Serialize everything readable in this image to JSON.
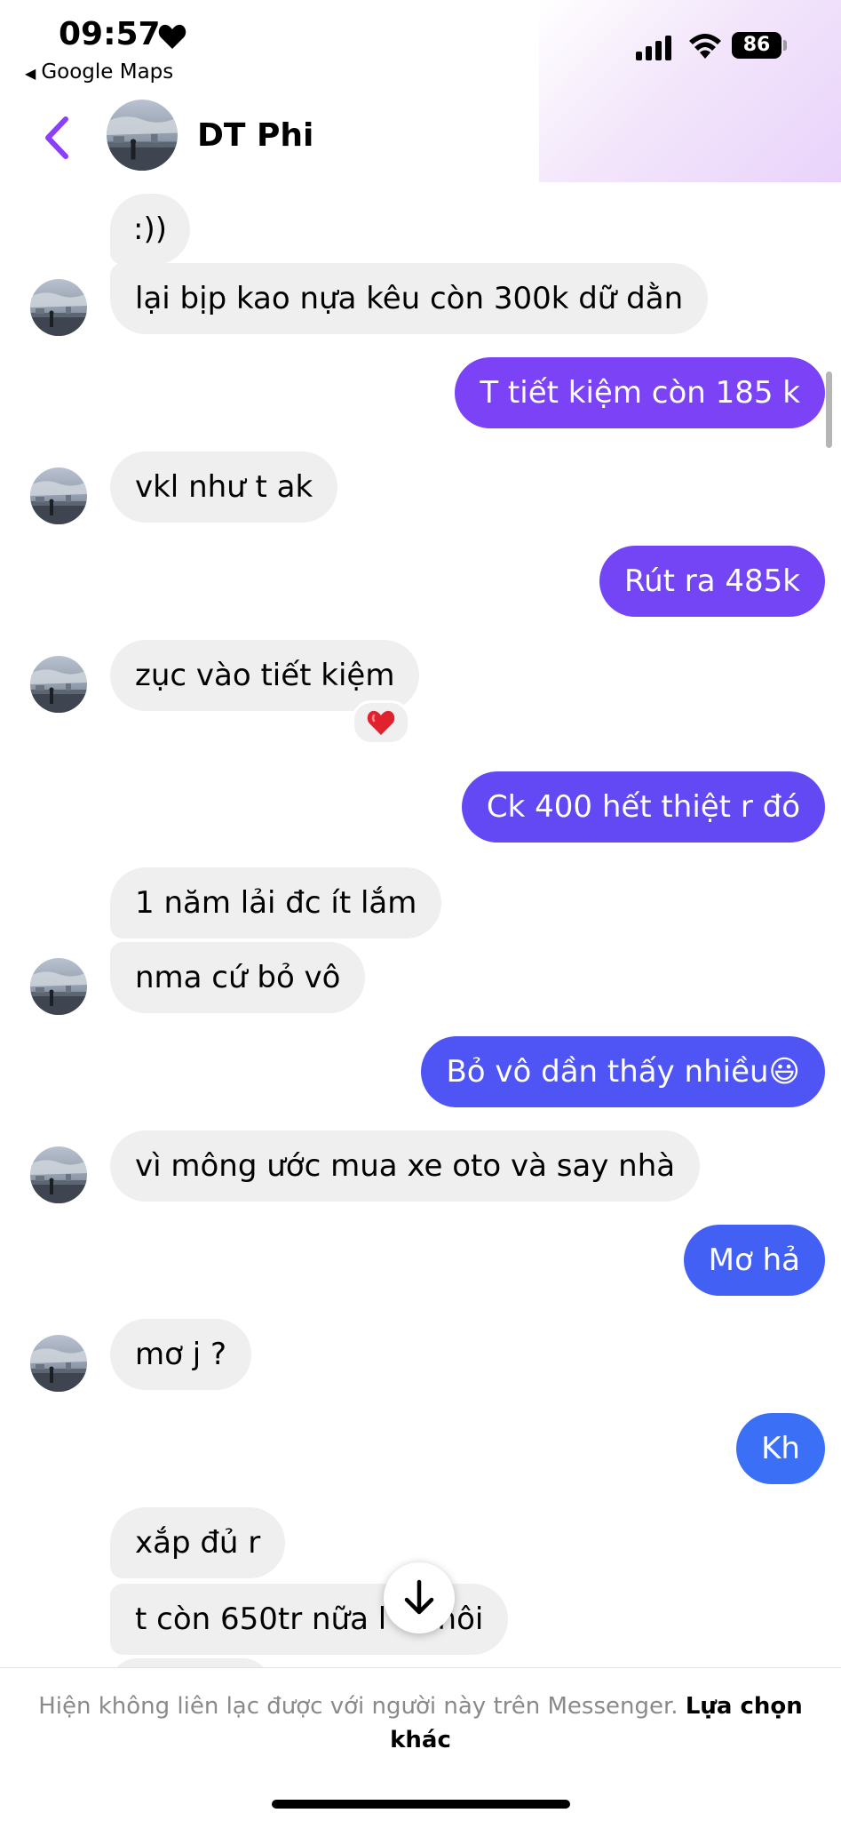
{
  "status_bar": {
    "time": "09:57",
    "back_app": "Google Maps",
    "battery": "86"
  },
  "header": {
    "contact_name": "DT Phi"
  },
  "messages": [
    {
      "text": ":))"
    },
    {
      "text": "lại bịp kao nựa kêu còn 300k dữ dằn"
    },
    {
      "text": "T tiết kiệm còn 185 k"
    },
    {
      "text": "vkl như t ak"
    },
    {
      "text": "Rút ra 485k"
    },
    {
      "text": "zục vào tiết kiệm"
    },
    {
      "text": "Ck 400 hết thiệt r đó"
    },
    {
      "text": "1 năm lải đc ít lắm"
    },
    {
      "text": "nma cứ bỏ vô"
    },
    {
      "text": "Bỏ vô dần thấy nhiều😃"
    },
    {
      "text": "vì mông ước mua xe oto và say nhà"
    },
    {
      "text": "Mơ hả"
    },
    {
      "text": "mơ j ?"
    },
    {
      "text": "Kh"
    },
    {
      "text": "xắp đủ r"
    },
    {
      "text": "t còn 650tr nữa l"
    },
    {
      "text": "thôi"
    }
  ],
  "reaction": {
    "icon": "heart-reaction-icon"
  },
  "footer": {
    "notice": "Hiện không liên lạc được với người này trên Messenger.",
    "link": "Lựa chọn khác"
  },
  "colors": {
    "accent_purple": "#8a3ffc",
    "outgoing_top": "#7b42f6",
    "outgoing_mid": "#5d4ef3",
    "outgoing_bottom": "#3b6ff5",
    "incoming": "#efefef"
  }
}
